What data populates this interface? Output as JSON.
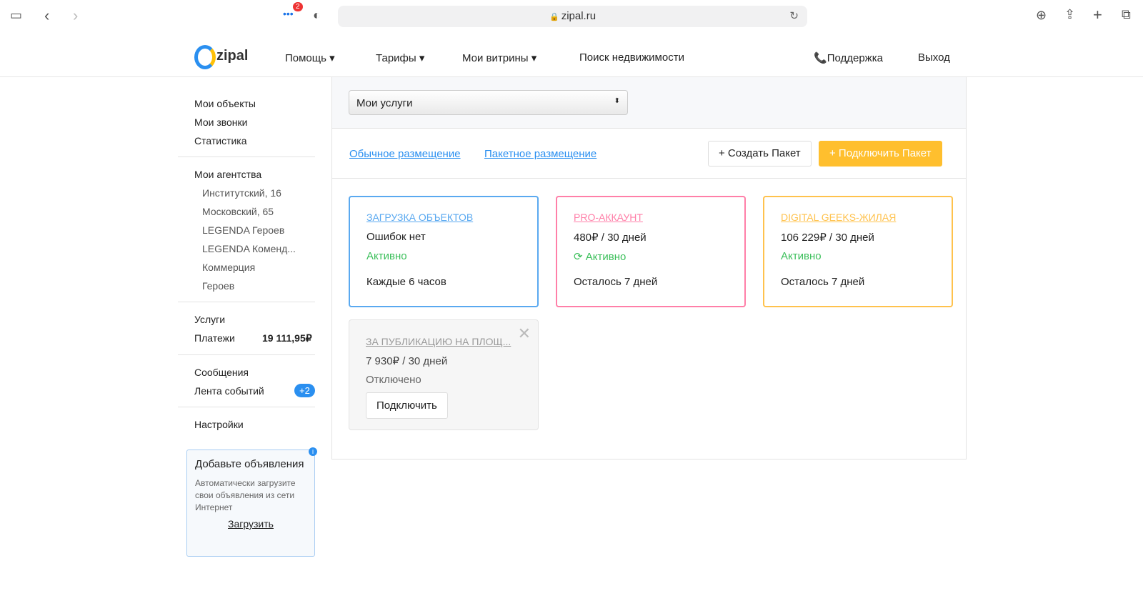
{
  "browser": {
    "url": "zipal.ru",
    "badge": "2"
  },
  "nav": {
    "logo": "zipal",
    "items": [
      "Помощь",
      "Тарифы",
      "Мои витрины",
      "Поиск недвижимости"
    ],
    "support": "Поддержка",
    "logout": "Выход"
  },
  "sidebar": {
    "top": [
      "Мои объекты",
      "Мои звонки",
      "Статистика"
    ],
    "agencies_title": "Мои агентства",
    "agencies": [
      "Институтский, 16",
      "Московский, 65",
      "LEGENDA Героев",
      "LEGENDA Коменд...",
      "Коммерция",
      "Героев"
    ],
    "services": "Услуги",
    "payments": "Платежи",
    "payments_value": "19 111,95₽",
    "messages": "Сообщения",
    "feed": "Лента событий",
    "feed_badge": "+2",
    "settings": "Настройки",
    "promo": {
      "title": "Добавьте объявления",
      "text": "Автоматически загрузите свои объявления из сети Интернет",
      "link": "Загрузить"
    }
  },
  "main": {
    "select": "Мои услуги",
    "tabs": [
      "Обычное размещение",
      "Пакетное размещение"
    ],
    "create": "+ Создать Пакет",
    "connect": "+ Подключить Пакет",
    "cards": [
      {
        "title": "ЗАГРУЗКА ОБЪЕКТОВ",
        "line1": "Ошибок нет",
        "status": "Активно",
        "footer": "Каждые 6 часов",
        "color": "#5aa9f0"
      },
      {
        "title": "PRO-АККАУНТ",
        "line1": "480₽  / 30 дней",
        "status": "Активно",
        "footer": "Осталось 7 дней",
        "color": "#ff7fa8"
      },
      {
        "title": "DIGITAL GEEKS-ЖИЛАЯ",
        "line1": "106 229₽  / 30 дней",
        "status": "Активно",
        "footer": "Осталось 7 дней",
        "color": "#ffc24d"
      }
    ],
    "disabled_card": {
      "title": "ЗА ПУБЛИКАЦИЮ НА ПЛОЩ...",
      "line1": "7 930₽  / 30 дней",
      "status": "Отключено",
      "button": "Подключить"
    }
  }
}
